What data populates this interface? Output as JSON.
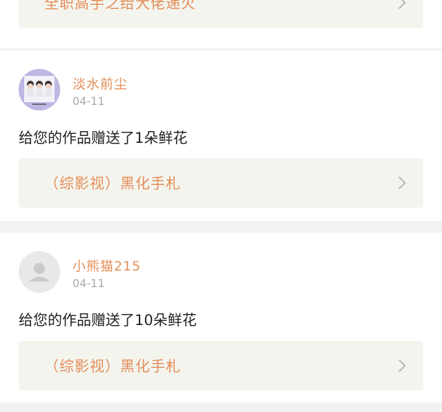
{
  "top_item": {
    "work_title": "全职高手之给大佬递火"
  },
  "notifications": [
    {
      "username": "淡水前尘",
      "date": "04-11",
      "message": "给您的作品赠送了1朵鲜花",
      "work_title": "（综影视）黑化手札"
    },
    {
      "username": "小熊猫215",
      "date": "04-11",
      "message": "给您的作品赠送了10朵鲜花",
      "work_title": "（综影视）黑化手札"
    }
  ],
  "colors": {
    "accent": "#e28d58",
    "separator": "#f2f2f2",
    "link_bg": "#f4f4ee"
  },
  "icons": {
    "link_arrow": "chevron-right-icon",
    "default_avatar": "default-user-icon"
  }
}
